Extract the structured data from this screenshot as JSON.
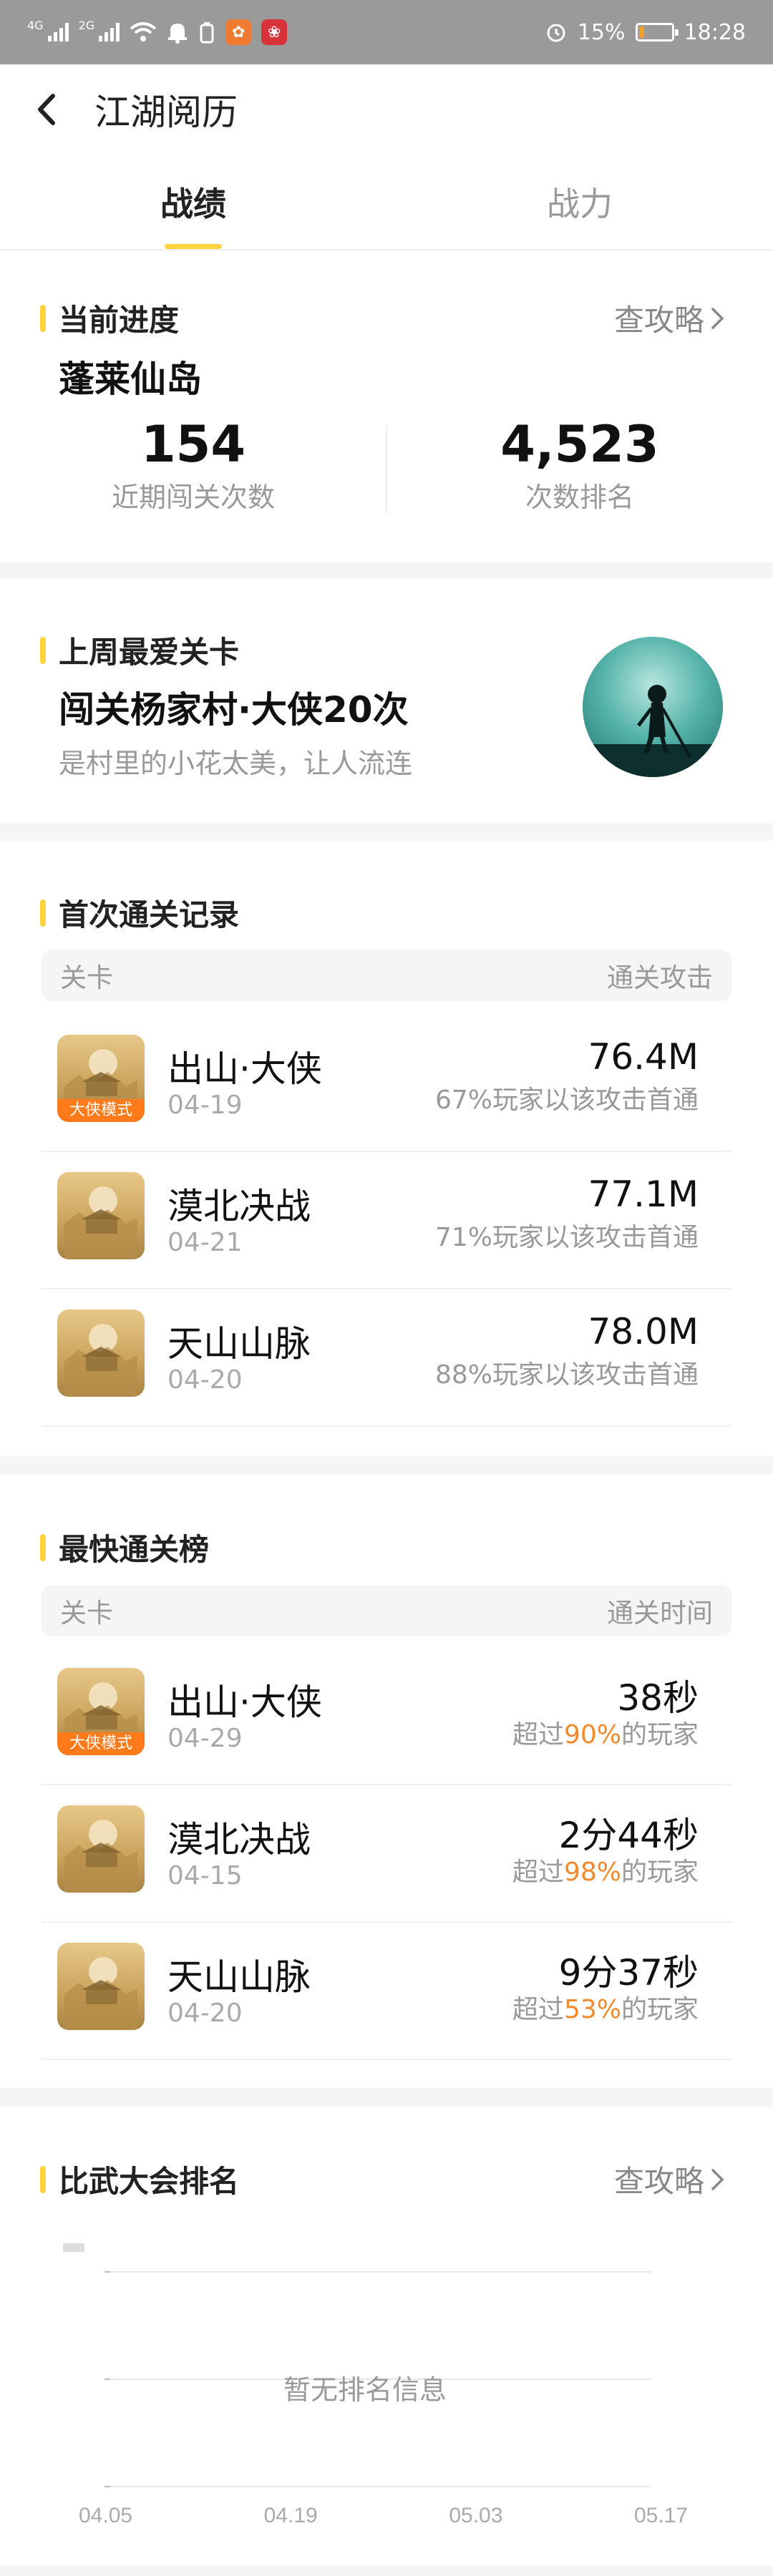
{
  "status": {
    "net1": "4G",
    "net2": "2G",
    "battery_pct": "15%",
    "battery_level": 0.15,
    "time": "18:28"
  },
  "header": {
    "title": "江湖阅历"
  },
  "tabs": [
    {
      "label": "战绩",
      "active": true
    },
    {
      "label": "战力",
      "active": false
    }
  ],
  "progress": {
    "title": "当前进度",
    "more": "查攻略",
    "location": "蓬莱仙岛",
    "stats": [
      {
        "value": "154",
        "label": "近期闯关次数"
      },
      {
        "value": "4,523",
        "label": "次数排名"
      }
    ]
  },
  "favorite": {
    "title": "上周最爱关卡",
    "headline": "闯关杨家村·大侠20次",
    "sub": "是村里的小花太美，让人流连"
  },
  "first_clear": {
    "title": "首次通关记录",
    "columns": [
      "关卡",
      "通关攻击"
    ],
    "rows": [
      {
        "name": "出山·大侠",
        "date": "04-19",
        "value": "76.4M",
        "note": "67%玩家以该攻击首通",
        "badge": "大侠模式"
      },
      {
        "name": "漠北决战",
        "date": "04-21",
        "value": "77.1M",
        "note": "71%玩家以该攻击首通",
        "badge": ""
      },
      {
        "name": "天山山脉",
        "date": "04-20",
        "value": "78.0M",
        "note": "88%玩家以该攻击首通",
        "badge": ""
      }
    ]
  },
  "fastest": {
    "title": "最快通关榜",
    "columns": [
      "关卡",
      "通关时间"
    ],
    "rows": [
      {
        "name": "出山·大侠",
        "date": "04-29",
        "value": "38秒",
        "note_pre": "超过",
        "pct": "90%",
        "note_post": "的玩家",
        "badge": "大侠模式"
      },
      {
        "name": "漠北决战",
        "date": "04-15",
        "value": "2分44秒",
        "note_pre": "超过",
        "pct": "98%",
        "note_post": "的玩家",
        "badge": ""
      },
      {
        "name": "天山山脉",
        "date": "04-20",
        "value": "9分37秒",
        "note_pre": "超过",
        "pct": "53%",
        "note_post": "的玩家",
        "badge": ""
      }
    ]
  },
  "ranking": {
    "title": "比武大会排名",
    "more": "查攻略",
    "empty_text": "暂无排名信息"
  },
  "chart_data": {
    "type": "line",
    "title": "",
    "categories": [
      "04.05",
      "04.19",
      "05.03",
      "05.17"
    ],
    "series": [],
    "empty_text": "暂无排名信息",
    "grid": true
  },
  "colors": {
    "accent": "#ffd33d",
    "highlight": "#f08a2c",
    "badge": "#ff7a1a"
  }
}
